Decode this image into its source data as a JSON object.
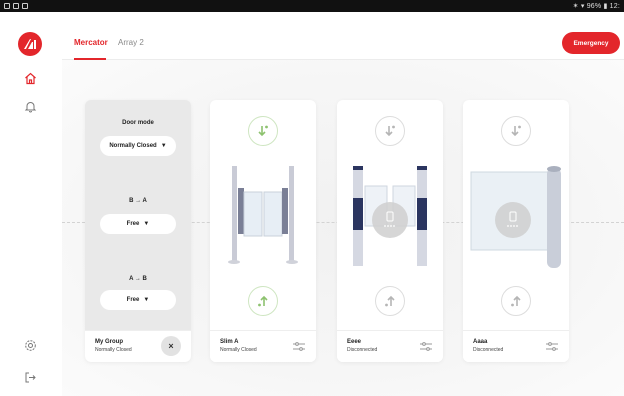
{
  "status_bar": {
    "right_text": "✶ ▾ 96% ▮ 12:"
  },
  "tabs": [
    {
      "label": "Mercator",
      "active": true
    },
    {
      "label": "Array 2",
      "active": false
    }
  ],
  "emergency_label": "Emergency",
  "group_card": {
    "door_mode_label": "Door mode",
    "door_mode_value": "Normally Closed",
    "b_to_a_label": "B → A",
    "b_to_a_value": "Free",
    "a_to_b_label": "A → B",
    "a_to_b_value": "Free",
    "footer_title": "My Group",
    "footer_sub": "Normally Closed",
    "close_glyph": "×"
  },
  "devices": [
    {
      "name": "Slim A",
      "status": "Normally Closed",
      "type": "swing-gate",
      "arrow_color": "#8dc26f"
    },
    {
      "name": "Eeee",
      "status": "Disconnected",
      "type": "speed-gate",
      "arrow_color": "#b5b5b5"
    },
    {
      "name": "Aaaa",
      "status": "Disconnected",
      "type": "glass-door",
      "arrow_color": "#b5b5b5"
    }
  ],
  "colors": {
    "accent": "#e3262b",
    "green": "#8dc26f",
    "muted": "#b5b5b5"
  }
}
